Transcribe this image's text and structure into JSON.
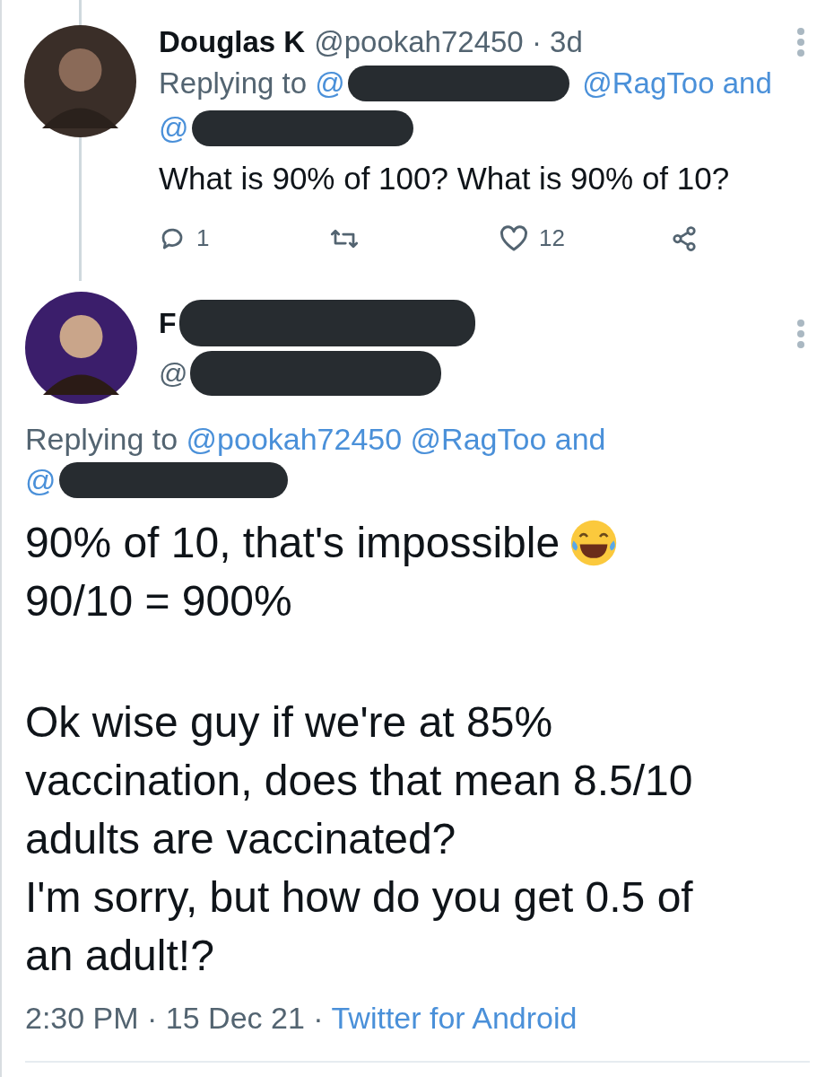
{
  "tweets": [
    {
      "name": {
        "text": "Douglas K",
        "redacted": false
      },
      "handle": {
        "text": "@pookah72450 · 3d",
        "redacted": false
      },
      "replying": [
        [
          {
            "kind": "label",
            "text": "Replying to "
          },
          {
            "kind": "mention",
            "text": "@",
            "redacted": true
          },
          {
            "kind": "mention",
            "text": "@RagToo and",
            "redacted": false
          }
        ],
        [
          {
            "kind": "mention",
            "text": "@",
            "redacted": true
          }
        ]
      ],
      "body": [
        {
          "text": "What is 90% of 100? What is 90% of 10?"
        }
      ],
      "actions": [
        {
          "kind": "reply",
          "count": "1"
        },
        {
          "kind": "retweet"
        },
        {
          "kind": "like",
          "count": "12"
        },
        {
          "kind": "share"
        }
      ]
    },
    {
      "name": {
        "text": "F",
        "redacted": true
      },
      "handle": {
        "text": "@",
        "redacted": true
      },
      "replying": [
        [
          {
            "kind": "label",
            "text": "Replying to "
          },
          {
            "kind": "mention",
            "text": "@pookah72450 @RagToo and",
            "redacted": false
          }
        ],
        [
          {
            "kind": "mention",
            "text": "@",
            "redacted": true
          }
        ]
      ],
      "body": [
        {
          "text": "90% of 10, that's impossible",
          "emoji": true
        },
        {
          "text": "90/10 = 900%",
          "gap_after": true
        },
        {
          "text": "Ok wise guy if we're at 85%"
        },
        {
          "text": "vaccination, does that mean 8.5/10"
        },
        {
          "text": "adults are vaccinated?"
        },
        {
          "text": "I'm sorry, but how do you get 0.5 of"
        },
        {
          "text": "an adult!?"
        }
      ],
      "meta": [
        {
          "kind": "label",
          "text": "2:30 PM · 15 Dec 21 · "
        },
        {
          "kind": "link",
          "text": "Twitter for Android"
        }
      ]
    }
  ]
}
